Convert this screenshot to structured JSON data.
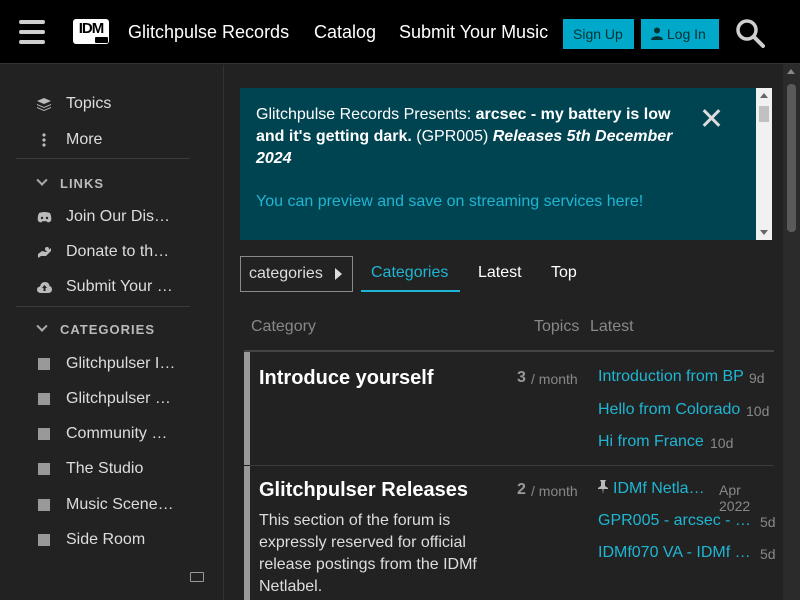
{
  "header": {
    "logo_text": "IDM",
    "site_title": "Glitchpulse Records",
    "nav": [
      "Catalog",
      "Submit Your Music"
    ],
    "signup_label": "Sign Up",
    "login_label": "Log In"
  },
  "sidebar": {
    "top_items": [
      {
        "label": "Topics",
        "icon": "layers-icon"
      },
      {
        "label": "More",
        "icon": "vertical-dots-icon"
      }
    ],
    "links_heading": "LINKS",
    "links": [
      {
        "label": "Join Our Discord",
        "icon": "discord-icon"
      },
      {
        "label": "Donate to the Netlabel",
        "icon": "donate-icon"
      },
      {
        "label": "Submit Your Music",
        "icon": "cloud-upload-icon"
      }
    ],
    "categories_heading": "CATEGORIES",
    "categories": [
      {
        "label": "Glitchpulser Introductions"
      },
      {
        "label": "Glitchpulser Releases"
      },
      {
        "label": "Community Releases"
      },
      {
        "label": "The Studio"
      },
      {
        "label": "Music Scene Discussion"
      },
      {
        "label": "Side Room"
      }
    ]
  },
  "banner": {
    "prefix": "Glitchpulse Records Presents: ",
    "title": "arcsec - my battery is low and it's getting dark.",
    "code": " (GPR005) ",
    "release": "Releases 5th December 2024",
    "link_text": "You can preview and save on streaming services here!"
  },
  "controls": {
    "dropdown_label": "categories",
    "tabs": [
      "Categories",
      "Latest",
      "Top"
    ]
  },
  "table": {
    "headers": {
      "category": "Category",
      "topics": "Topics",
      "latest": "Latest"
    },
    "rows": [
      {
        "name": "Introduce yourself",
        "description": "",
        "count": "3",
        "per": "/ month",
        "latest": [
          {
            "title": "Introduction from BP",
            "date": "9d"
          },
          {
            "title": "Hello from Colorado",
            "date": "10d"
          },
          {
            "title": "Hi from France",
            "date": "10d"
          }
        ]
      },
      {
        "name": "Glitchpulser Releases",
        "description": "This section of the forum is expressly reserved for official release postings from the IDMf Netlabel.",
        "count": "2",
        "per": "/ month",
        "latest": [
          {
            "title": "IDMf Netla…",
            "date": "Apr 2022",
            "pinned": true
          },
          {
            "title": "GPR005 - arcsec - …",
            "date": "5d"
          },
          {
            "title": "IDMf070 VA - IDMf …",
            "date": "5d"
          }
        ]
      }
    ]
  },
  "colors": {
    "accent": "#1fb6d3",
    "banner_bg": "#004452",
    "button_bg": "#00a8c9"
  }
}
